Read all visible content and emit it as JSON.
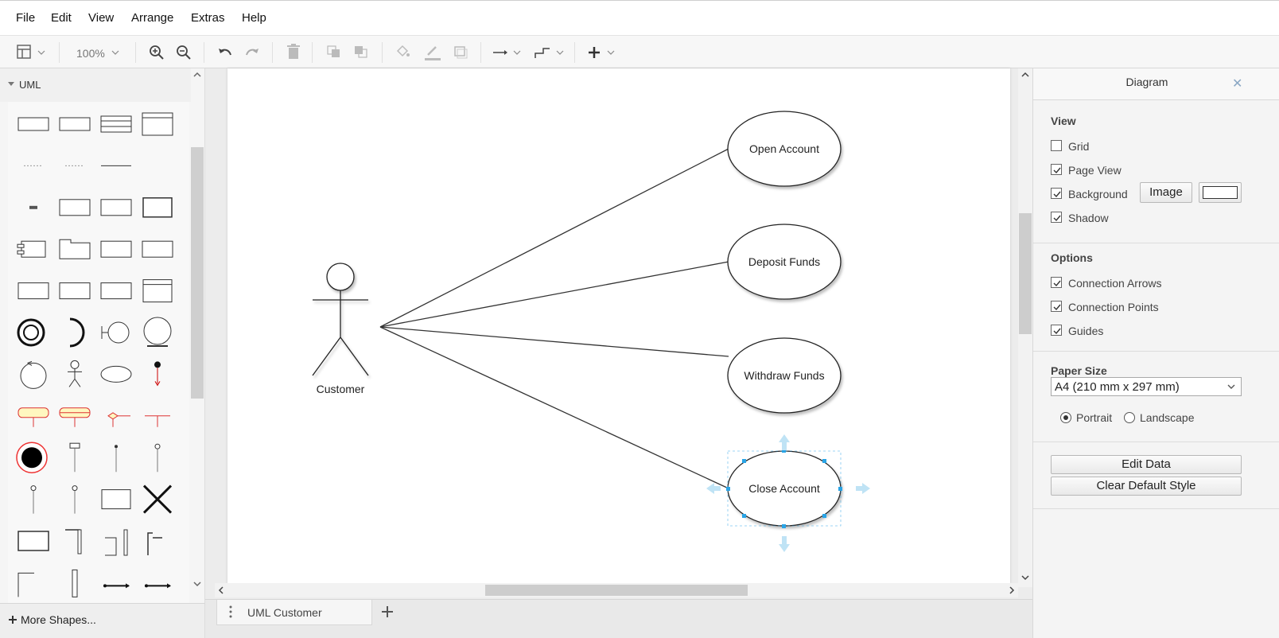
{
  "menu": [
    "File",
    "Edit",
    "View",
    "Arrange",
    "Extras",
    "Help"
  ],
  "toolbar": {
    "zoom": "100%",
    "icons": [
      "page-view-icon",
      "zoom-in-icon",
      "zoom-out-icon",
      "undo-icon",
      "redo-icon",
      "delete-icon",
      "to-front-icon",
      "to-back-icon",
      "fill-color-icon",
      "line-color-icon",
      "shadow-icon",
      "connection-icon",
      "waypoints-icon",
      "insert-icon"
    ]
  },
  "sidebar": {
    "palette_title": "UML",
    "more_shapes": "More Shapes...",
    "shape_tiles": [
      "Class",
      "Interface",
      "Class with attributes",
      "Class with sections",
      "Attribute",
      "Method",
      "Separator",
      "",
      "Title",
      "Note",
      "Text with note",
      "Container",
      "Component",
      "Package",
      "Object",
      "Frame",
      "Rectangle",
      "Rectangle",
      "Table",
      "Classifier",
      "Interface Circle",
      "Required Interface",
      "Boundary Object",
      "Entity Object",
      "Control Object",
      "Actor",
      "Use Case",
      "Activation",
      "Action",
      "Decision Action",
      "Choice",
      "Receive Signal",
      "Final State",
      "Lifeline",
      "Dashed Lifeline",
      "Lifeline",
      "Lifeline",
      "Lifeline",
      "Frame",
      "Destroy",
      "Rectangle",
      "Self Message",
      "Message",
      "Self call",
      "Fragment",
      "Fragment",
      "Message",
      "Message"
    ]
  },
  "diagram": {
    "actor": "Customer",
    "use_cases": [
      "Open Account",
      "Deposit Funds",
      "Withdraw Funds",
      "Close Account"
    ],
    "selected_use_case": "Close Account"
  },
  "tabs": {
    "page": "UML Customer"
  },
  "panel": {
    "title": "Diagram",
    "view": {
      "title": "View",
      "grid": "Grid",
      "page_view": "Page View",
      "background": "Background",
      "shadow": "Shadow",
      "image_button": "Image"
    },
    "options": {
      "title": "Options",
      "connection_arrows": "Connection Arrows",
      "connection_points": "Connection Points",
      "guides": "Guides"
    },
    "paper": {
      "title": "Paper Size",
      "size": "A4 (210 mm x 297 mm)",
      "portrait": "Portrait",
      "landscape": "Landscape"
    },
    "buttons": {
      "edit_data": "Edit Data",
      "clear_style": "Clear Default Style"
    }
  },
  "colors": {
    "selection": "#29a4e6",
    "panel_bg": "#f4f4f4"
  }
}
